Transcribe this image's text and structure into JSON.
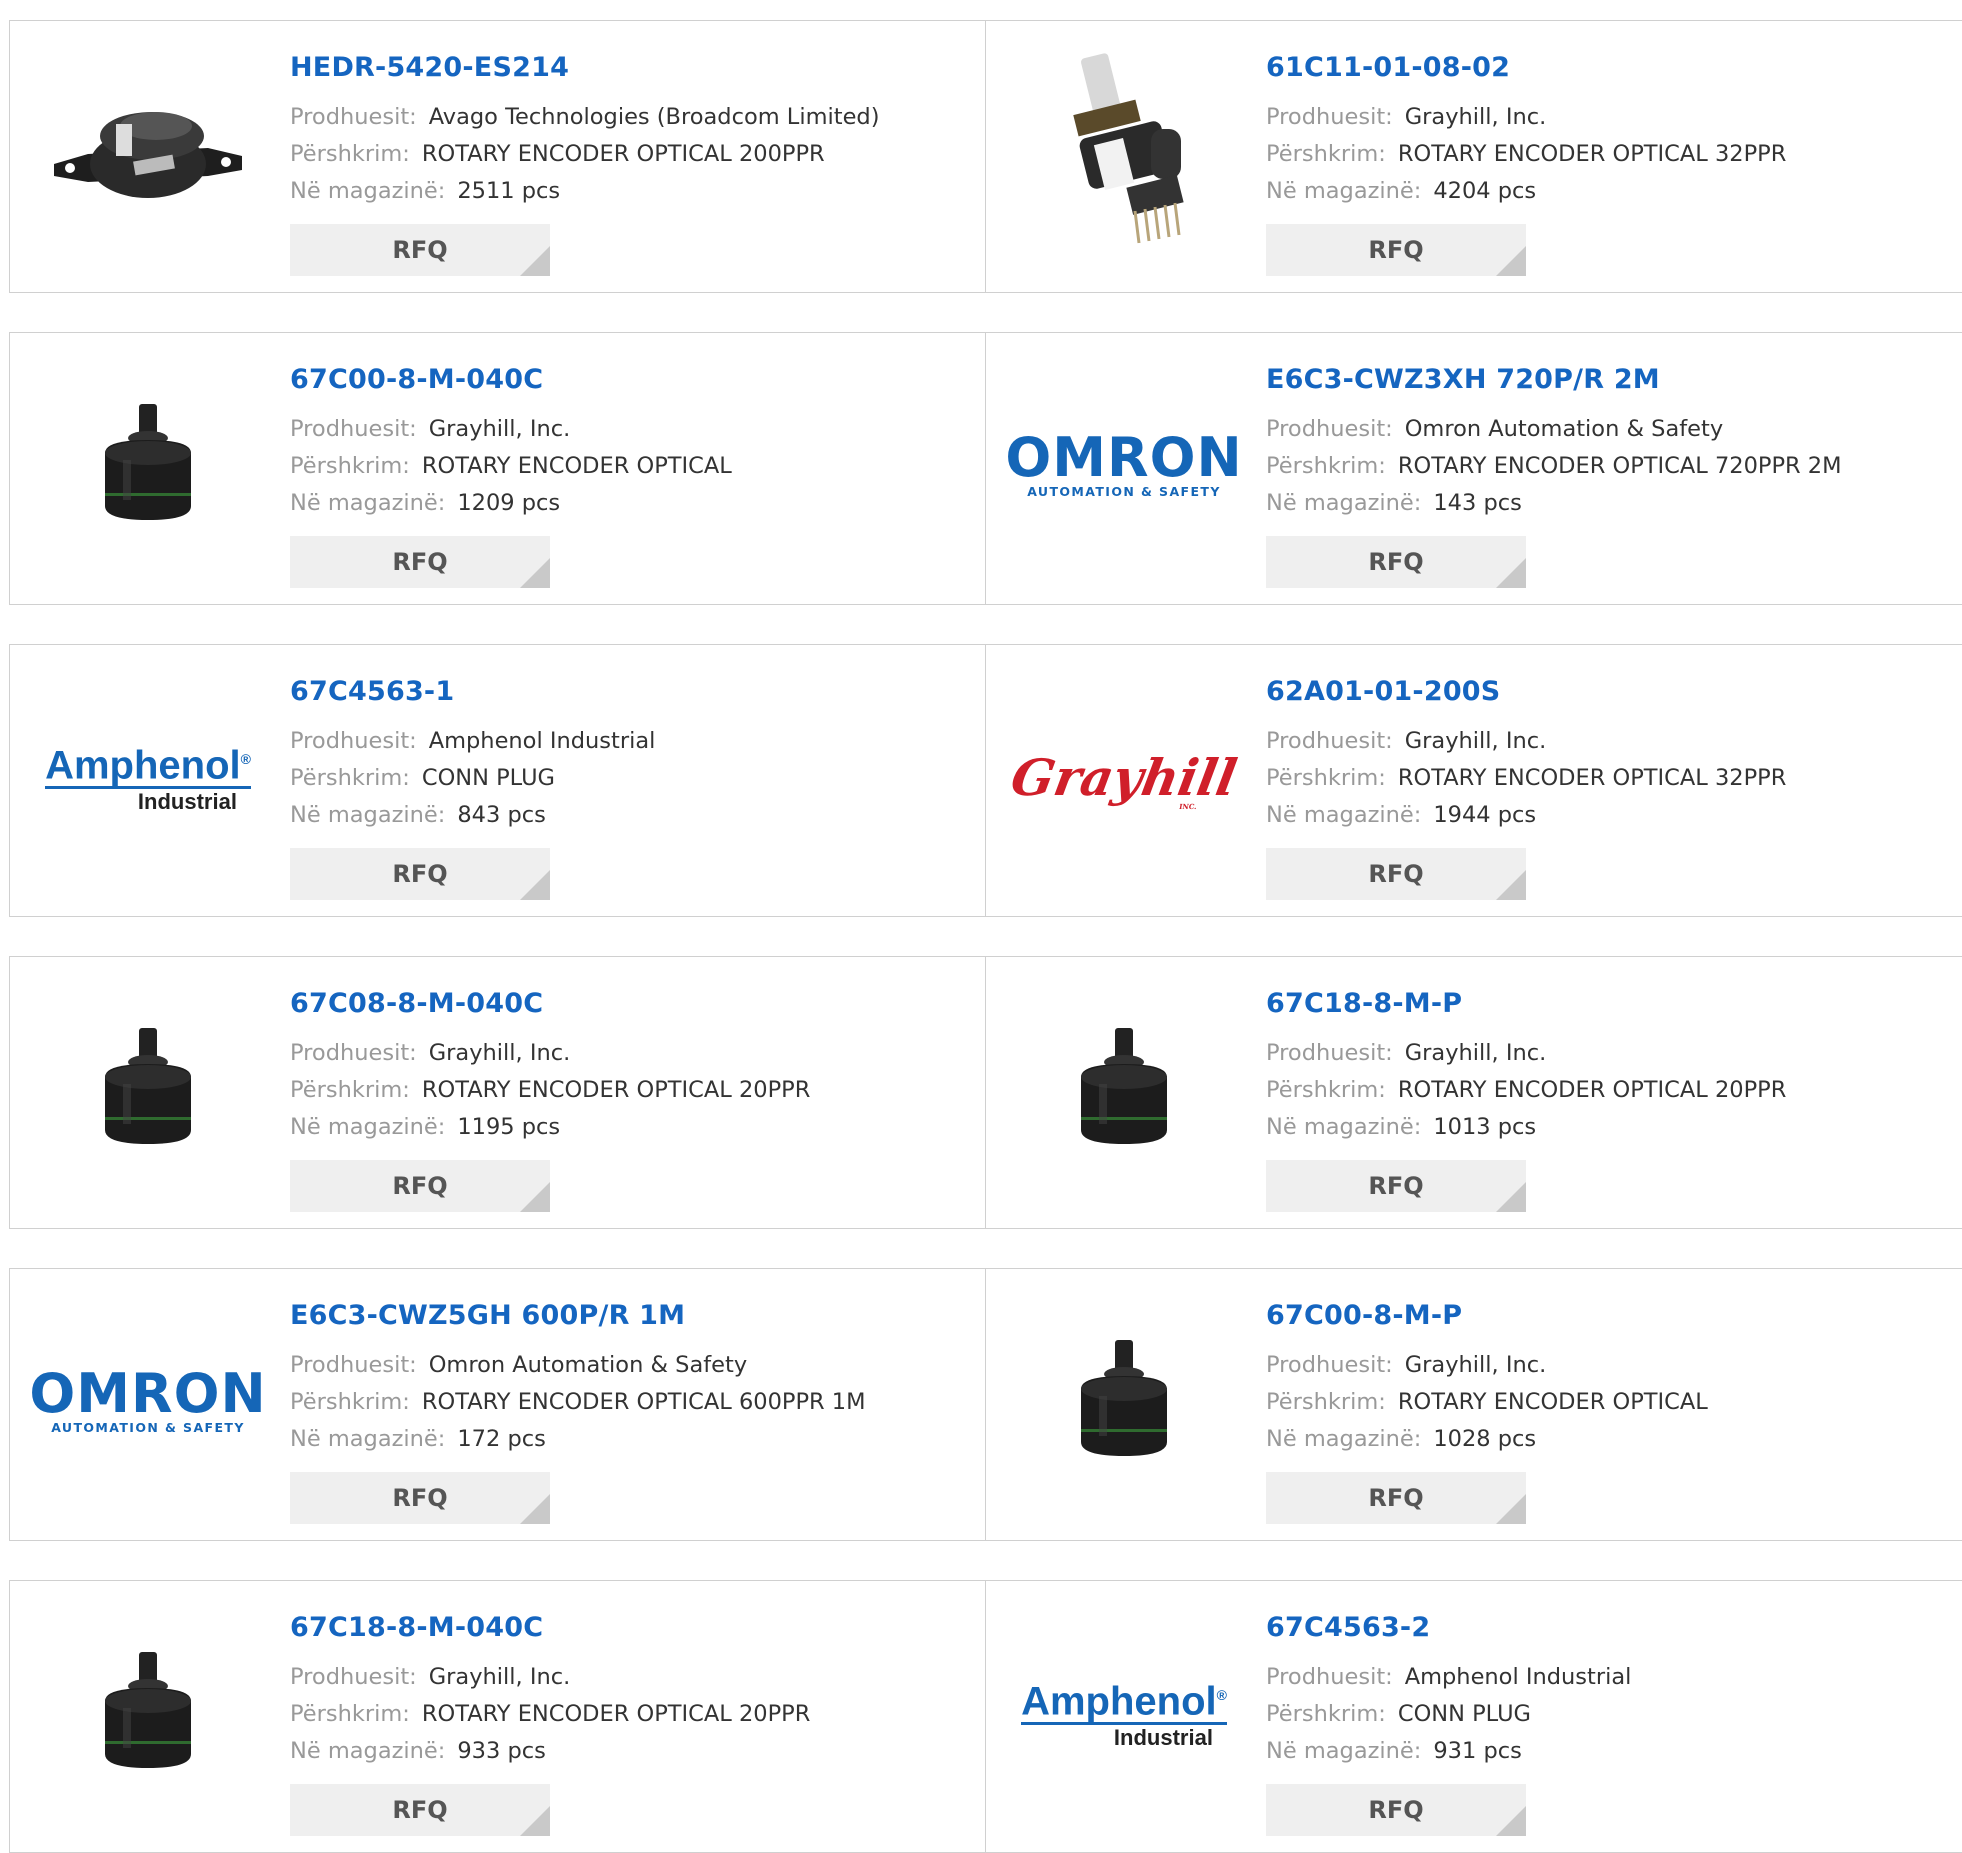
{
  "labels": {
    "manufacturer": "Prodhuesit:",
    "description": "Përshkrim:",
    "stock": "Në magazinë:",
    "rfq": "RFQ"
  },
  "products": [
    {
      "part": "HEDR-5420-ES214",
      "manufacturer": "Avago Technologies (Broadcom Limited)",
      "description": "ROTARY ENCODER OPTICAL 200PPR",
      "stock": "2511 pcs",
      "image": "encoder-flange"
    },
    {
      "part": "61C11-01-08-02",
      "manufacturer": "Grayhill, Inc.",
      "description": "ROTARY ENCODER OPTICAL 32PPR",
      "stock": "4204 pcs",
      "image": "encoder-shaft-pins"
    },
    {
      "part": "67C00-8-M-040C",
      "manufacturer": "Grayhill, Inc.",
      "description": "ROTARY ENCODER OPTICAL",
      "stock": "1209 pcs",
      "image": "encoder-black"
    },
    {
      "part": "E6C3-CWZ3XH 720P/R 2M",
      "manufacturer": "Omron Automation & Safety",
      "description": "ROTARY ENCODER OPTICAL 720PPR 2M",
      "stock": "143 pcs",
      "image": "omron-logo",
      "logo": {
        "big": "OMRON",
        "small": "AUTOMATION & SAFETY"
      }
    },
    {
      "part": "67C4563-1",
      "manufacturer": "Amphenol Industrial",
      "description": "CONN PLUG",
      "stock": "843 pcs",
      "image": "amphenol-logo",
      "logo": {
        "big": "Amphenol",
        "small": "Industrial"
      }
    },
    {
      "part": "62A01-01-200S",
      "manufacturer": "Grayhill, Inc.",
      "description": "ROTARY ENCODER OPTICAL 32PPR",
      "stock": "1944 pcs",
      "image": "grayhill-logo",
      "logo": {
        "big": "Grayhill",
        "small": "INC."
      }
    },
    {
      "part": "67C08-8-M-040C",
      "manufacturer": "Grayhill, Inc.",
      "description": "ROTARY ENCODER OPTICAL 20PPR",
      "stock": "1195 pcs",
      "image": "encoder-black"
    },
    {
      "part": "67C18-8-M-P",
      "manufacturer": "Grayhill, Inc.",
      "description": "ROTARY ENCODER OPTICAL 20PPR",
      "stock": "1013 pcs",
      "image": "encoder-black"
    },
    {
      "part": "E6C3-CWZ5GH 600P/R 1M",
      "manufacturer": "Omron Automation & Safety",
      "description": "ROTARY ENCODER OPTICAL 600PPR 1M",
      "stock": "172 pcs",
      "image": "omron-logo",
      "logo": {
        "big": "OMRON",
        "small": "AUTOMATION & SAFETY"
      }
    },
    {
      "part": "67C00-8-M-P",
      "manufacturer": "Grayhill, Inc.",
      "description": "ROTARY ENCODER OPTICAL",
      "stock": "1028 pcs",
      "image": "encoder-black"
    },
    {
      "part": "67C18-8-M-040C",
      "manufacturer": "Grayhill, Inc.",
      "description": "ROTARY ENCODER OPTICAL 20PPR",
      "stock": "933 pcs",
      "image": "encoder-black"
    },
    {
      "part": "67C4563-2",
      "manufacturer": "Amphenol Industrial",
      "description": "CONN PLUG",
      "stock": "931 pcs",
      "image": "amphenol-logo",
      "logo": {
        "big": "Amphenol",
        "small": "Industrial"
      }
    }
  ],
  "colors": {
    "link": "#1565c0",
    "label": "#999999",
    "button_bg": "#efefef",
    "border": "#d0d0d0"
  }
}
